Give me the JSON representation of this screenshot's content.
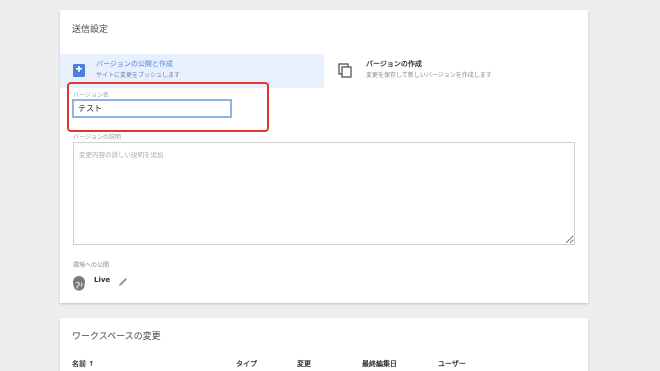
{
  "publish_settings": {
    "title": "送信設定",
    "options": [
      {
        "title": "バージョンの公開と作成",
        "subtitle": "サイトに変更をプッシュします",
        "icon": "publish-icon",
        "selected": true
      },
      {
        "title": "バージョンの作成",
        "subtitle": "変更を保存して新しいバージョンを作成します",
        "icon": "copy-icon",
        "selected": false
      }
    ],
    "version_name": {
      "label": "バージョン名",
      "value": "テスト"
    },
    "version_description": {
      "label": "バージョンの説明",
      "placeholder": "変更内容の詳しい説明を追加",
      "value": ""
    },
    "environment": {
      "label": "環境への公開",
      "name": "Live",
      "icon": "globe-icon",
      "edit_icon": "pencil-icon"
    }
  },
  "workspace_changes": {
    "title": "ワークスペースの変更",
    "columns": [
      "名前 ↑",
      "タイプ",
      "変更",
      "最終編集日",
      "ユーザー"
    ]
  },
  "colors": {
    "selected_option_bg": "#e8f0fe",
    "accent": "#4d7fe0",
    "highlight_box": "#e0382c",
    "page_bg": "#ededed"
  }
}
